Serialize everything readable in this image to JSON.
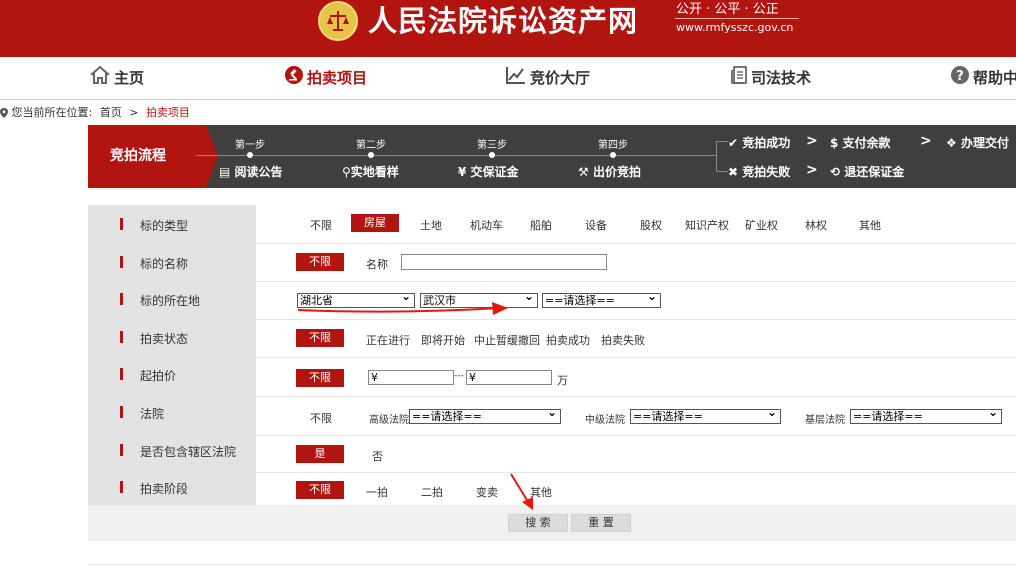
{
  "header": {
    "site_name": "人民法院诉讼资产网",
    "slogan": "公开 · 公平 · 公正",
    "domain": "www.rmfysszc.gov.cn",
    "brand_color": "#b2140f"
  },
  "nav": {
    "items": [
      {
        "label": "主页",
        "icon": "home-icon"
      },
      {
        "label": "拍卖项目",
        "icon": "gavel-icon",
        "active": true
      },
      {
        "label": "竞价大厅",
        "icon": "chart-icon"
      },
      {
        "label": "司法技术",
        "icon": "document-icon"
      },
      {
        "label": "帮助中",
        "icon": "help-icon"
      }
    ]
  },
  "breadcrumb": {
    "prefix": "您当前所在位置:",
    "home": "首页",
    "sep": ">",
    "current": "拍卖项目"
  },
  "process": {
    "title": "竞拍流程",
    "steps": [
      {
        "title": "第一步",
        "label": "阅读公告"
      },
      {
        "title": "第二步",
        "label": "实地看样"
      },
      {
        "title": "第三步",
        "label": "交保证金"
      },
      {
        "title": "第四步",
        "label": "出价竞拍"
      }
    ],
    "success": {
      "result": "竞拍成功",
      "next1": "支付余款",
      "next2": "办理交付"
    },
    "failure": {
      "result": "竞拍失败",
      "next1": "退还保证金"
    },
    "chevron": ">"
  },
  "filters": {
    "type": {
      "label": "标的类型",
      "options": [
        "不限",
        "房屋",
        "土地",
        "机动车",
        "船舶",
        "设备",
        "股权",
        "知识产权",
        "矿业权",
        "林权",
        "其他"
      ],
      "selected": "房屋"
    },
    "name": {
      "label": "标的名称",
      "unlimited": "不限",
      "field_label": "名称",
      "value": ""
    },
    "location": {
      "label": "标的所在地",
      "province": "湖北省",
      "city": "武汉市",
      "district": "==请选择=="
    },
    "status": {
      "label": "拍卖状态",
      "unlimited": "不限",
      "options": [
        "正在进行",
        "即将开始",
        "中止暂缓撤回",
        "拍卖成功",
        "拍卖失败"
      ]
    },
    "price": {
      "label": "起拍价",
      "unlimited": "不限",
      "min": "¥",
      "dash": "---",
      "max": "¥",
      "unit": "万"
    },
    "court": {
      "label": "法院",
      "unlimited": "不限",
      "high_label": "高级法院",
      "high_value": "==请选择==",
      "mid_label": "中级法院",
      "mid_value": "==请选择==",
      "base_label": "基层法院",
      "base_value": "==请选择=="
    },
    "district_court": {
      "label": "是否包含辖区法院",
      "yes": "是",
      "no": "否"
    },
    "stage": {
      "label": "拍卖阶段",
      "unlimited": "不限",
      "options": [
        "一拍",
        "二拍",
        "变卖",
        "其他"
      ]
    }
  },
  "actions": {
    "search": "搜 索",
    "reset": "重 置"
  }
}
